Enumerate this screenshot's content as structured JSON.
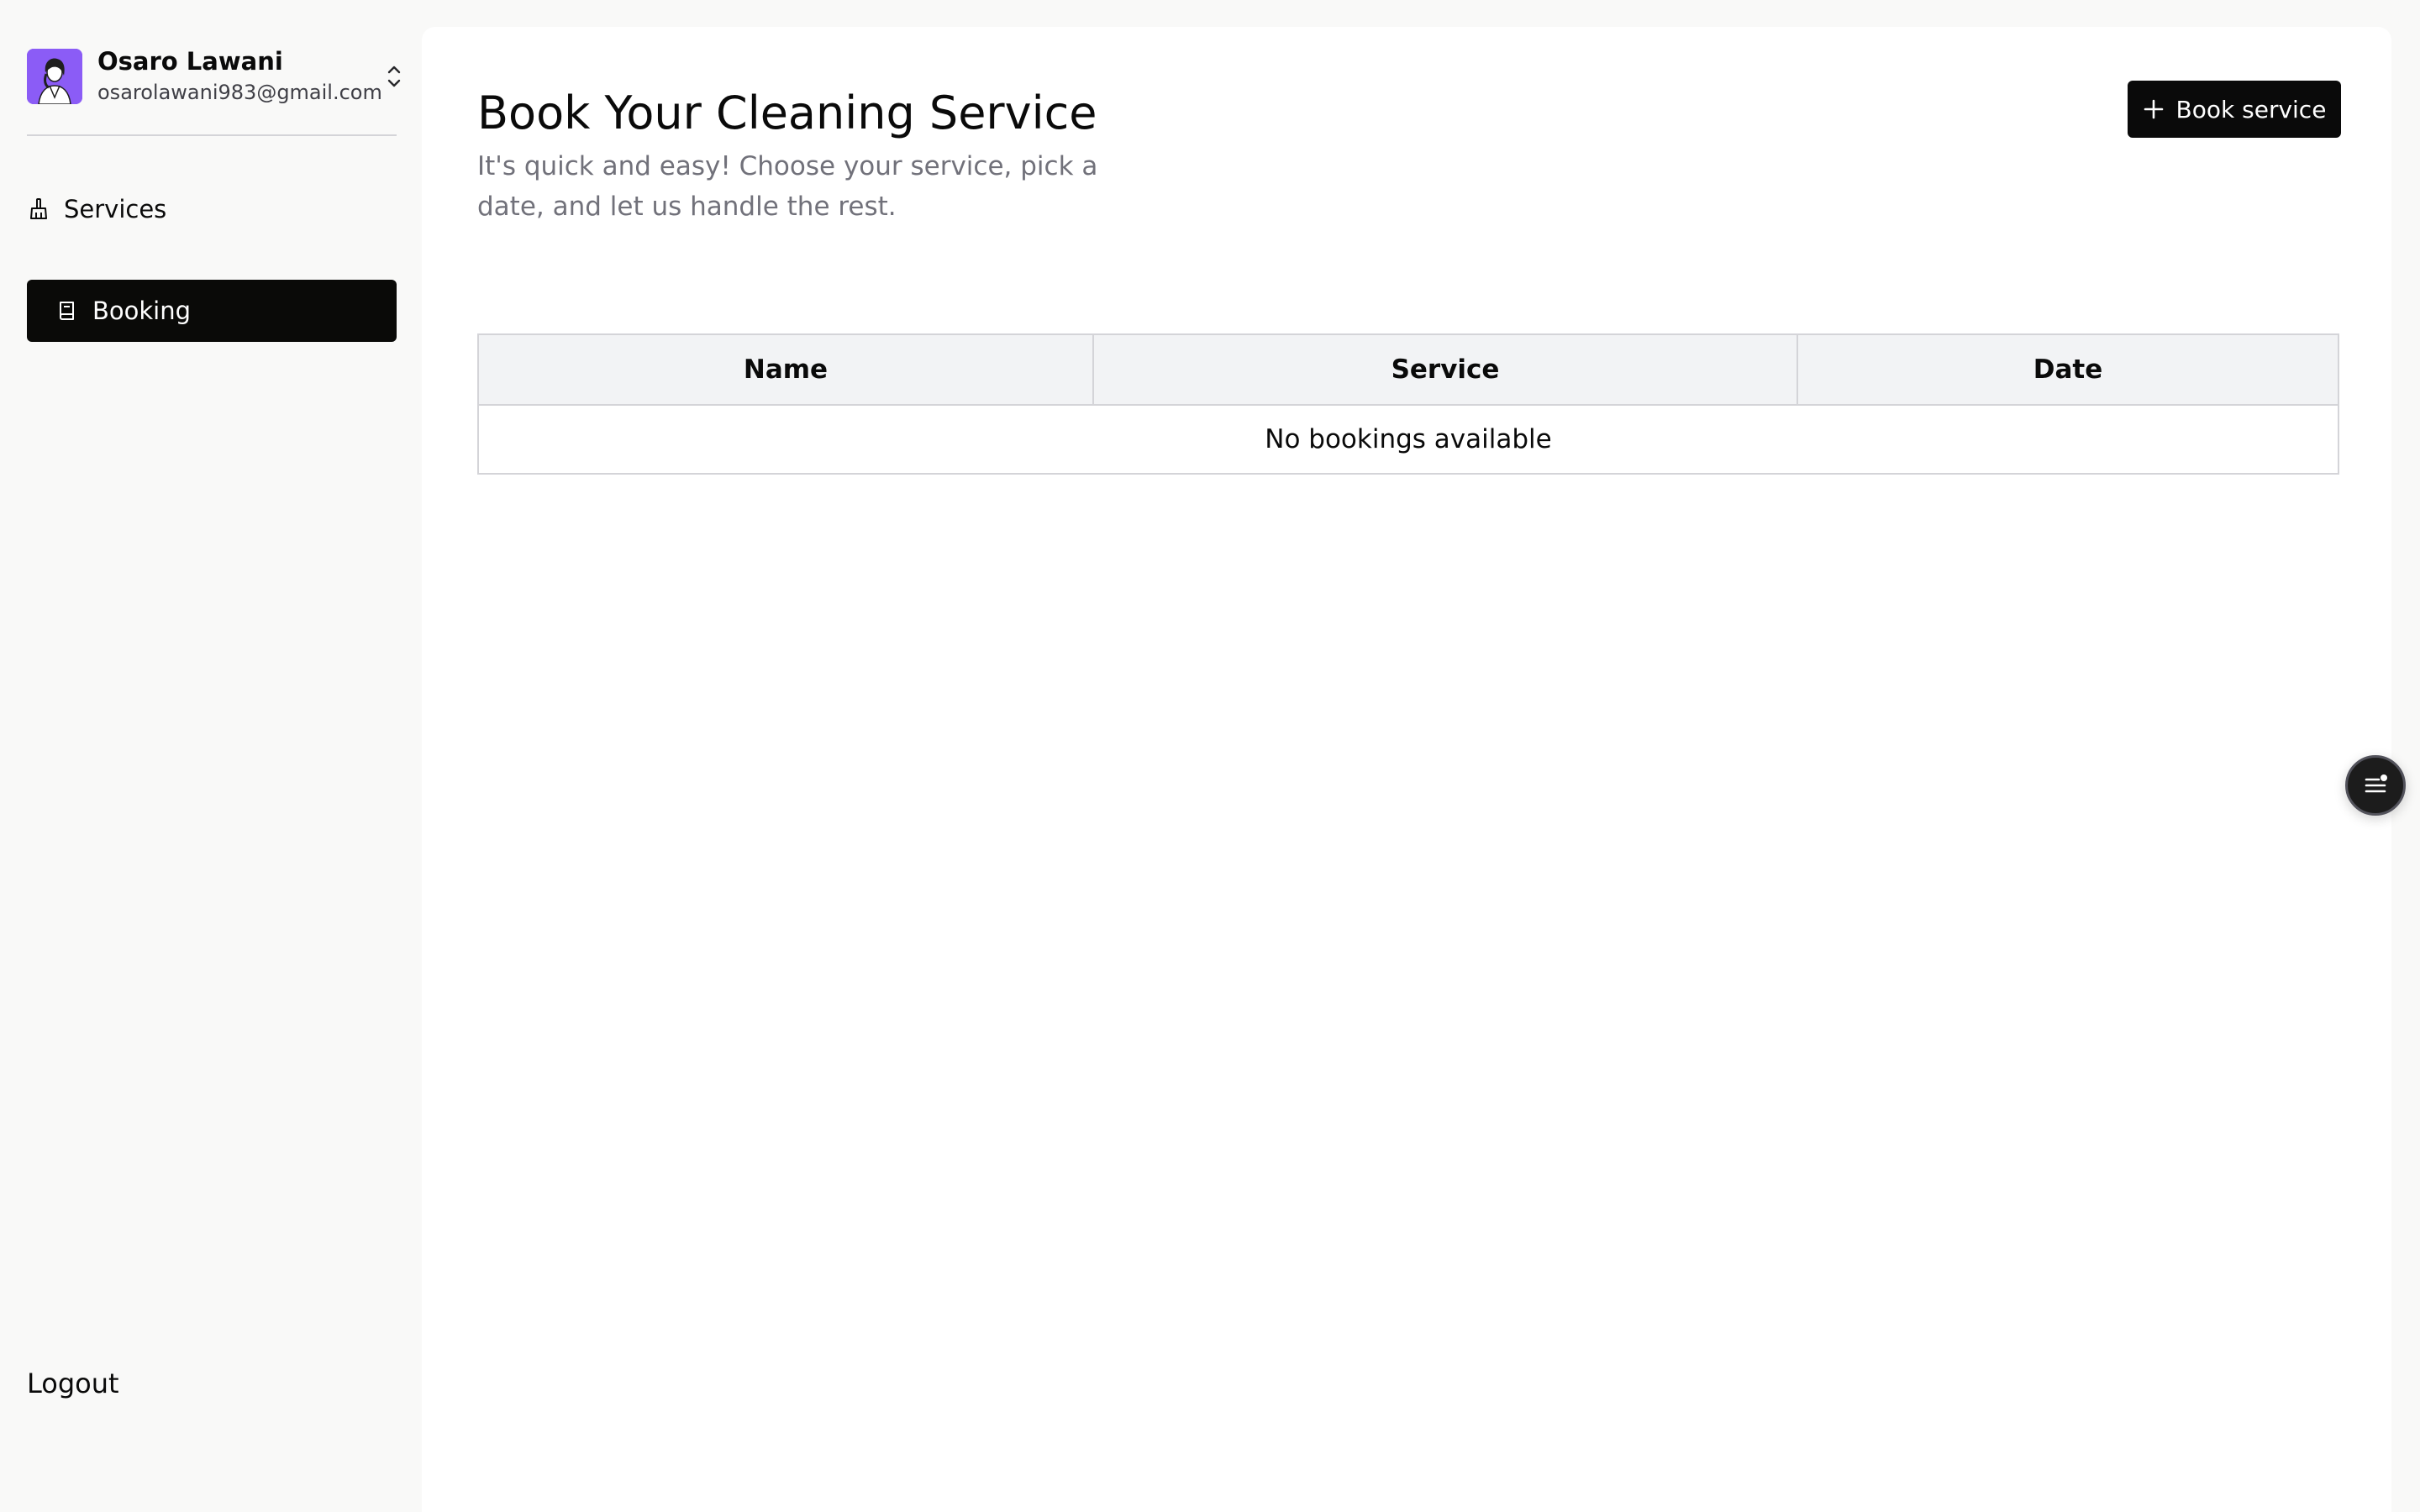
{
  "user": {
    "name": "Osaro Lawani",
    "email": "osarolawani983@gmail.com"
  },
  "sidebar": {
    "items": [
      {
        "label": "Services",
        "icon": "broom-icon",
        "active": false
      },
      {
        "label": "Booking",
        "icon": "book-icon",
        "active": true
      }
    ],
    "logout_label": "Logout"
  },
  "main": {
    "title": "Book Your Cleaning Service",
    "subtitle": "It's quick and easy! Choose your service, pick a date, and let us handle the rest.",
    "book_button_label": "Book service",
    "table": {
      "columns": [
        "Name",
        "Service",
        "Date"
      ],
      "empty_message": "No bookings available"
    }
  },
  "colors": {
    "background": "#f9f9f8",
    "panel": "#ffffff",
    "accent": "#0a0a0a",
    "avatar_bg": "#8b5cf6",
    "table_header_bg": "#f2f3f5",
    "border": "#d4d4d8",
    "muted_text": "#71717a"
  },
  "icons": {
    "user_switch": "chevron-up-down-icon",
    "book_button": "plus-icon",
    "floating_button": "menu-notification-icon"
  }
}
